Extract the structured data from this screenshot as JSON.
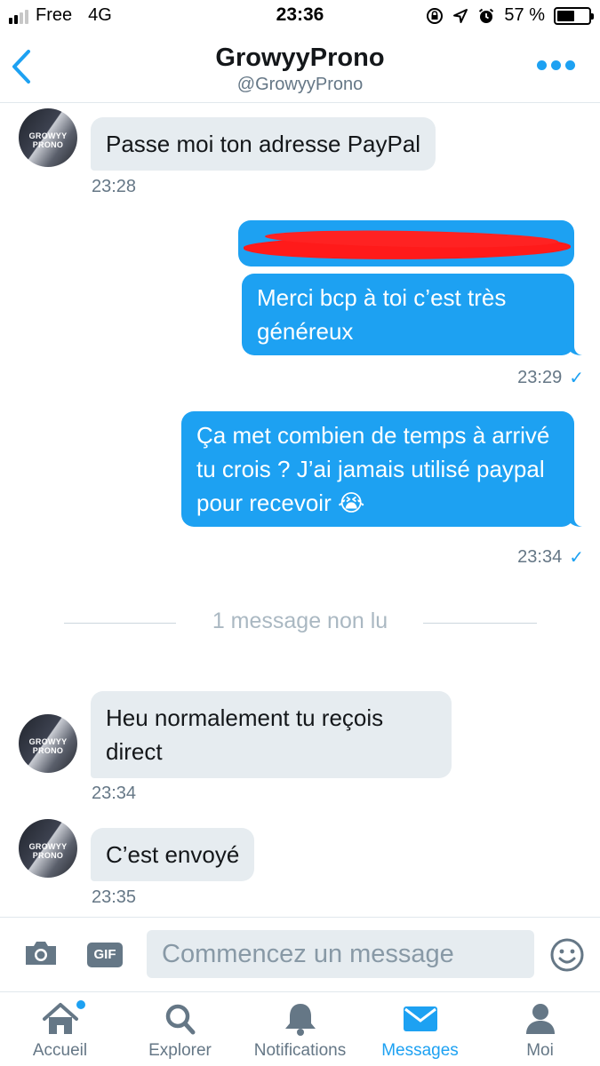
{
  "status_bar": {
    "carrier": "Free",
    "network": "4G",
    "time": "23:36",
    "battery_percent": "57 %",
    "battery_level": 0.57,
    "signal_bars": 4,
    "signal_active": 2
  },
  "header": {
    "title": "GrowyyProno",
    "handle": "@GrowyyProno"
  },
  "conversation": {
    "avatar_text": "GROWYY PRONO",
    "messages": [
      {
        "direction": "incoming",
        "text": "Passe moi ton adresse PayPal",
        "time": "23:28"
      },
      {
        "direction": "outgoing",
        "text": "[redacted]",
        "redacted": true
      },
      {
        "direction": "outgoing",
        "text": "Merci bcp à toi c’est très généreux",
        "time": "23:29",
        "read": true
      },
      {
        "direction": "outgoing",
        "text": "Ça met combien de temps à arrivé tu crois ? J’ai jamais utilisé paypal pour recevoir",
        "emoji": "😭",
        "time": "23:34",
        "read": true
      },
      {
        "direction": "incoming",
        "text": "Heu normalement tu reçois direct",
        "time": "23:34"
      },
      {
        "direction": "incoming",
        "text": "C’est envoyé",
        "time": "23:35"
      }
    ],
    "unread_divider": "1 message non lu",
    "read_mark": "✓"
  },
  "composer": {
    "placeholder": "Commencez un message",
    "gif_label": "GIF"
  },
  "tabs": [
    {
      "label": "Accueil",
      "icon": "home-icon",
      "active": false,
      "badge": true
    },
    {
      "label": "Explorer",
      "icon": "search-icon",
      "active": false
    },
    {
      "label": "Notifications",
      "icon": "bell-icon",
      "active": false
    },
    {
      "label": "Messages",
      "icon": "envelope-icon",
      "active": true
    },
    {
      "label": "Moi",
      "icon": "person-icon",
      "active": false
    }
  ],
  "colors": {
    "accent": "#1da1f2",
    "incoming_bubble": "#e6ecf0",
    "muted_text": "#657786",
    "redaction": "#ff1a1a"
  }
}
